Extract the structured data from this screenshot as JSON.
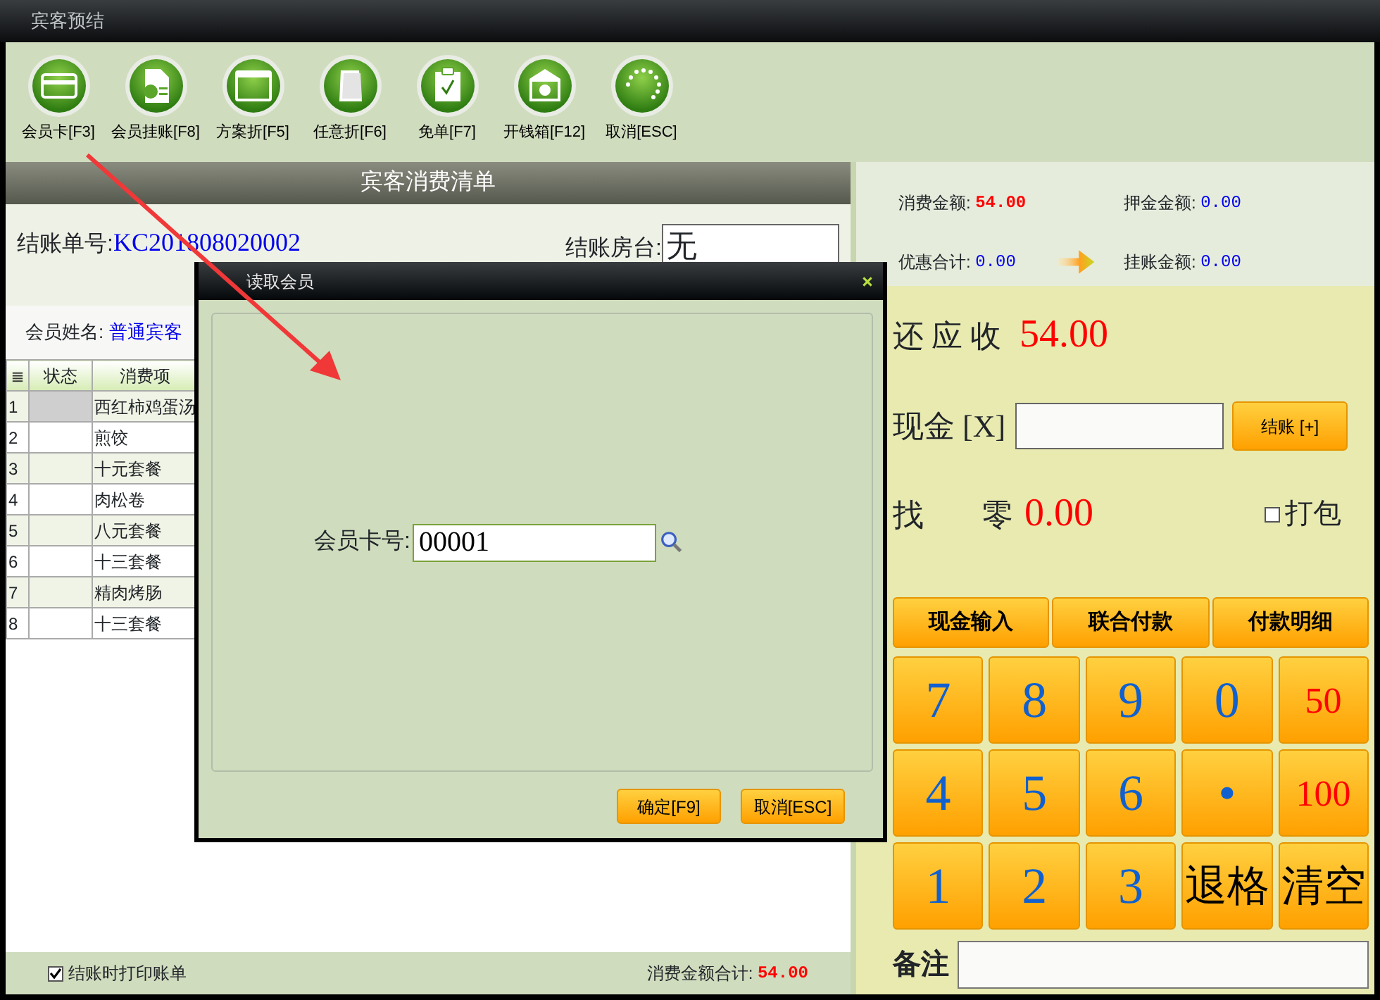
{
  "window": {
    "title": "宾客预结"
  },
  "toolbar": [
    {
      "label": "会员卡[F3]"
    },
    {
      "label": "会员挂账[F8]"
    },
    {
      "label": "方案折[F5]"
    },
    {
      "label": "任意折[F6]"
    },
    {
      "label": "免单[F7]"
    },
    {
      "label": "开钱箱[F12]"
    },
    {
      "label": "取消[ESC]"
    }
  ],
  "bill": {
    "title": "宾客消费清单",
    "number_label": "结账单号:",
    "number": "KC201808020002",
    "room_label": "结账房台:",
    "room": "无",
    "member_label": "会员姓名:",
    "member": "普通宾客"
  },
  "table": {
    "columns": [
      "状态",
      "消费项"
    ],
    "rows": [
      {
        "no": "1",
        "item": "西红柿鸡蛋汤",
        "selected": true
      },
      {
        "no": "2",
        "item": "煎饺",
        "selected": false
      },
      {
        "no": "3",
        "item": "十元套餐",
        "selected": false
      },
      {
        "no": "4",
        "item": "肉松卷",
        "selected": false
      },
      {
        "no": "5",
        "item": "八元套餐",
        "selected": false
      },
      {
        "no": "6",
        "item": "十三套餐",
        "selected": false
      },
      {
        "no": "7",
        "item": "精肉烤肠",
        "selected": false
      },
      {
        "no": "8",
        "item": "十三套餐",
        "selected": false
      }
    ]
  },
  "footer": {
    "print_bill": {
      "label": "结账时打印账单",
      "checked": true
    },
    "total_label": "消费金额合计:",
    "total": "54.00"
  },
  "summary": [
    {
      "label": "消费金额:",
      "value": "54.00",
      "emphasis": true
    },
    {
      "label": "押金金额:",
      "value": "0.00",
      "emphasis": false
    },
    {
      "label": "优惠合计:",
      "value": "0.00",
      "emphasis": false
    },
    {
      "label": "挂账金额:",
      "value": "0.00",
      "emphasis": false
    }
  ],
  "payment": {
    "due_label": "还 应 收",
    "due": "54.00",
    "cash_label": "现金 [X]",
    "checkout_button": "结账 [+]",
    "change_label": "找 零",
    "change": "0.00",
    "pack": {
      "label": "打包",
      "checked": false
    }
  },
  "keypad": {
    "tabs": [
      "现金输入",
      "联合付款",
      "付款明细"
    ],
    "keys": [
      {
        "label": "7",
        "kind": "digit"
      },
      {
        "label": "8",
        "kind": "digit"
      },
      {
        "label": "9",
        "kind": "digit"
      },
      {
        "label": "0",
        "kind": "digit"
      },
      {
        "label": "50",
        "kind": "amount"
      },
      {
        "label": "4",
        "kind": "digit"
      },
      {
        "label": "5",
        "kind": "digit"
      },
      {
        "label": "6",
        "kind": "digit"
      },
      {
        "label": "•",
        "kind": "digit"
      },
      {
        "label": "100",
        "kind": "amount"
      },
      {
        "label": "1",
        "kind": "digit"
      },
      {
        "label": "2",
        "kind": "digit"
      },
      {
        "label": "3",
        "kind": "digit"
      },
      {
        "label": "退格",
        "kind": "action"
      },
      {
        "label": "清空",
        "kind": "action"
      }
    ]
  },
  "note": {
    "label": "备注"
  },
  "dialog": {
    "title": "读取会员",
    "field_label": "会员卡号:",
    "field_value": "00001",
    "buttons": [
      "确定[F9]",
      "取消[ESC]"
    ]
  }
}
